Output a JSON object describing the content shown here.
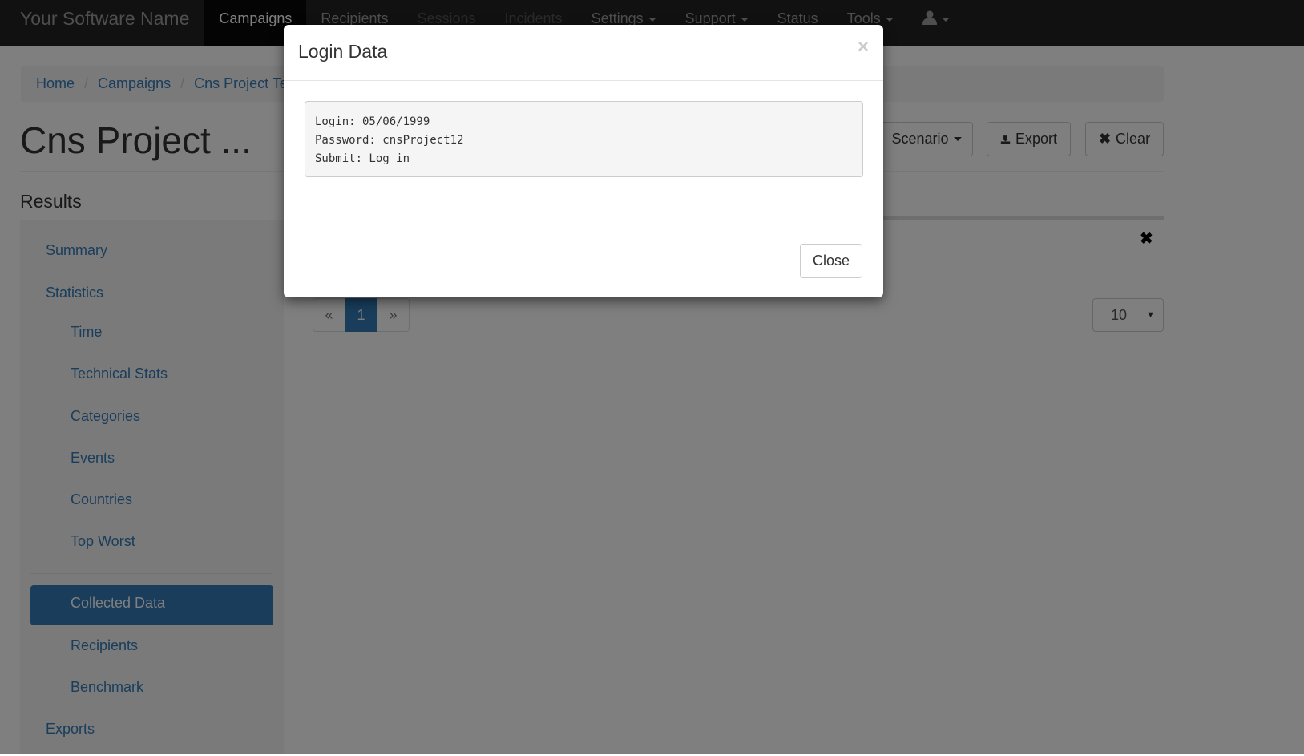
{
  "navbar": {
    "brand": "Your Software Name",
    "items": [
      {
        "label": "Campaigns",
        "active": true
      },
      {
        "label": "Recipients"
      },
      {
        "label": "Sessions",
        "disabled": true
      },
      {
        "label": "Incidents",
        "disabled": true
      },
      {
        "label": "Settings",
        "dropdown": true
      },
      {
        "label": "Support",
        "dropdown": true
      },
      {
        "label": "Status"
      },
      {
        "label": "Tools",
        "dropdown": true
      }
    ]
  },
  "breadcrumb": [
    "Home",
    "Campaigns",
    "Cns Project Te"
  ],
  "page_title": "Cns Project ...",
  "toolbar": {
    "scenario_label": "Scenario",
    "export_label": "Export",
    "clear_label": "Clear"
  },
  "results_title": "Results",
  "sidebar": {
    "items": [
      {
        "label": "Summary"
      },
      {
        "label": "Statistics"
      },
      {
        "label": "Time"
      },
      {
        "label": "Technical Stats"
      },
      {
        "label": "Categories"
      },
      {
        "label": "Events"
      },
      {
        "label": "Countries"
      },
      {
        "label": "Top Worst"
      },
      {
        "label": "Collected Data",
        "active": true
      },
      {
        "label": "Recipients"
      },
      {
        "label": "Benchmark"
      },
      {
        "label": "Exports"
      }
    ]
  },
  "pagination": {
    "prev": "«",
    "current": "1",
    "next": "»"
  },
  "page_size": "10",
  "modal": {
    "title": "Login Data",
    "lines": [
      "Login: 05/06/1999",
      "Password: cnsProject12",
      "Submit: Log in"
    ],
    "close_label": "Close"
  },
  "colors": {
    "navbar": "#222222",
    "accent": "#337ab7"
  }
}
